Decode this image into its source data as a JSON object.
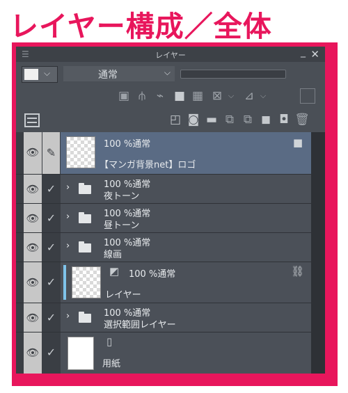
{
  "heading": "レイヤー構成／全体",
  "panel": {
    "title": "レイヤー",
    "grip": "☰",
    "minimize": "_",
    "close": "✕",
    "blend_mode": "通常",
    "chevron": "⌵"
  },
  "layers": [
    {
      "opacity": "100 %通常",
      "name": "【マンガ背景net】ロゴ",
      "type": "raster",
      "selected": true,
      "locked": true
    },
    {
      "opacity": "100 %通常",
      "name": "夜トーン",
      "type": "folder"
    },
    {
      "opacity": "100 %通常",
      "name": "昼トーン",
      "type": "folder"
    },
    {
      "opacity": "100 %通常",
      "name": "線画",
      "type": "folder"
    },
    {
      "opacity": "100 %通常",
      "name": "レイヤー",
      "type": "raster"
    },
    {
      "opacity": "100 %通常",
      "name": "選択範囲レイヤー",
      "type": "folder"
    },
    {
      "opacity": "",
      "name": "用紙",
      "type": "paper"
    }
  ],
  "glyphs": {
    "eye": "👁",
    "check": "✓",
    "pen": "✎",
    "caret": "›",
    "lock": "🔒",
    "link": "⛓"
  },
  "colors": {
    "accent": "#e8165c",
    "panel": "#4a4f56",
    "selected": "#5a6b84"
  }
}
